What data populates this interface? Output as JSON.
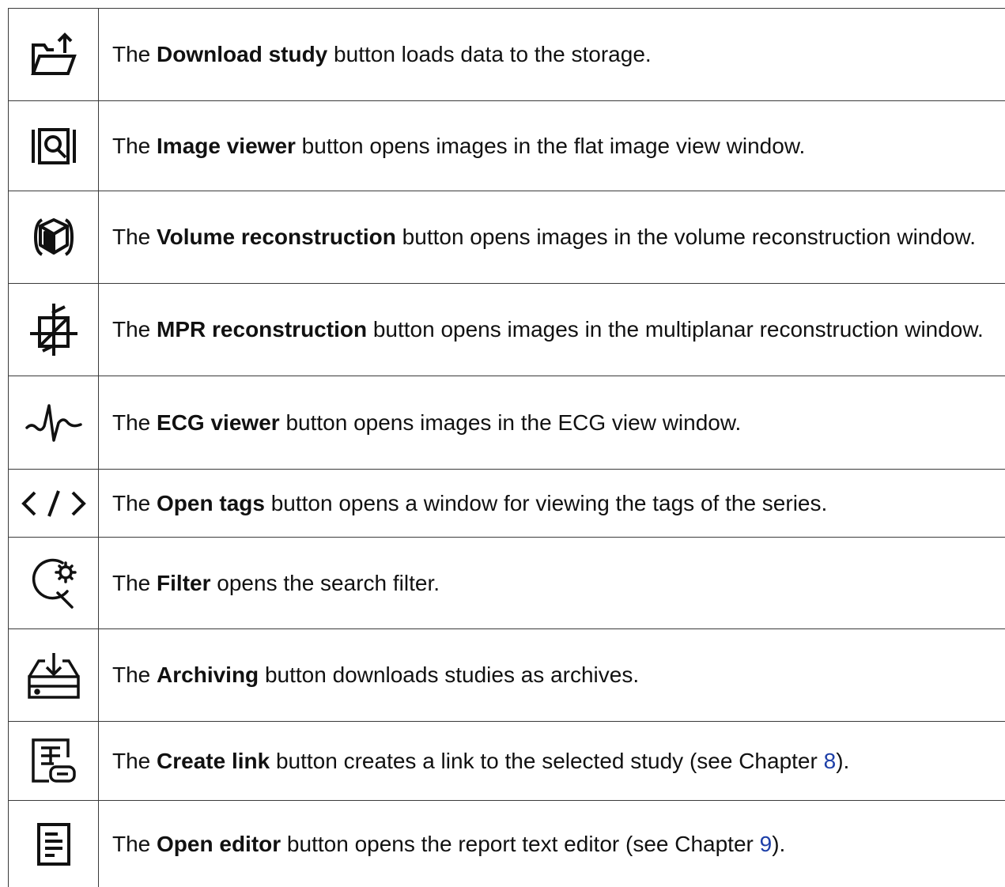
{
  "rows": [
    {
      "icon": "folder-upload-icon",
      "pre": "The ",
      "bold": "Download study",
      "post": " button loads data to the storage."
    },
    {
      "icon": "image-viewer-icon",
      "pre": "The ",
      "bold": "Image viewer",
      "post": " button opens images in the flat image view window."
    },
    {
      "icon": "volume-cube-icon",
      "pre": "The ",
      "bold": "Volume reconstruction",
      "post": " button opens images in the volume reconstruction window."
    },
    {
      "icon": "mpr-planes-icon",
      "pre": "The ",
      "bold": "MPR reconstruction",
      "post": " button opens images in the multiplanar reconstruction window."
    },
    {
      "icon": "ecg-wave-icon",
      "pre": "The ",
      "bold": "ECG viewer",
      "post": " button opens images in the ECG view window."
    },
    {
      "icon": "code-tags-icon",
      "pre": "The ",
      "bold": "Open tags",
      "post": " button opens a window for viewing the tags of the series."
    },
    {
      "icon": "search-filter-icon",
      "pre": "The ",
      "bold": "Filter",
      "post": " opens the search filter."
    },
    {
      "icon": "archive-download-icon",
      "pre": "The ",
      "bold": "Archiving",
      "post": " button downloads studies as archives."
    },
    {
      "icon": "create-link-icon",
      "pre": "The ",
      "bold": "Create link",
      "post": " button creates a link to the selected study (see Chapter ",
      "link": "8",
      "tail": ")."
    },
    {
      "icon": "document-editor-icon",
      "pre": "The ",
      "bold": "Open editor",
      "post": " button opens the report text editor (see Chapter ",
      "link": "9",
      "tail": ")."
    }
  ],
  "colors": {
    "border": "#3a3a3a",
    "text": "#111111",
    "link": "#1d3fa8"
  }
}
